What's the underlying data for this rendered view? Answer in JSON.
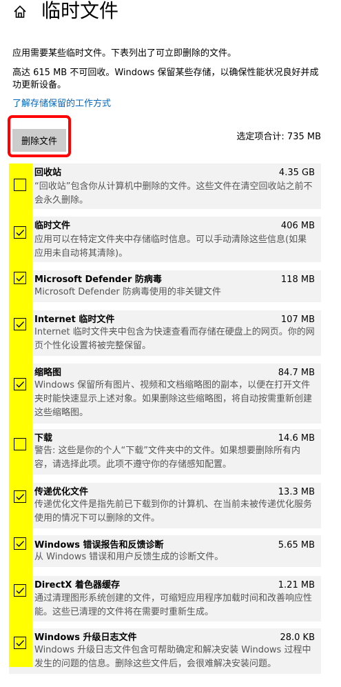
{
  "page": {
    "title": "临时文件"
  },
  "description": {
    "line1": "应用需要某些临时文件。下表列出了可立即删除的文件。",
    "line2": "高达 615 MB 不可回收。Windows 保留某些存储，以确保性能状况良好并成功更新设备。"
  },
  "link": {
    "learn_reserved": "了解存储保留的工作方式"
  },
  "actions": {
    "delete_label": "删除文件",
    "selected_total": "选定项合计: 735 MB"
  },
  "items": [
    {
      "title": "回收站",
      "size": "4.35 GB",
      "desc": "“回收站”包含你从计算机中删除的文件。这些文件在清空回收站之前不会永久删除。",
      "checked": false
    },
    {
      "title": "临时文件",
      "size": "406 MB",
      "desc": "应用可以在特定文件夹中存储临时信息。可以手动清除这些信息(如果应用未自动将其清除)。",
      "checked": true
    },
    {
      "title": "Microsoft Defender 防病毒",
      "size": "118 MB",
      "desc": "Microsoft Defender 防病毒使用的非关键文件",
      "checked": true
    },
    {
      "title": "Internet 临时文件",
      "size": "107 MB",
      "desc": "Internet 临时文件夹中包含为快速查看而存储在硬盘上的网页。你的网页个性化设置将被完整保留。",
      "checked": true
    },
    {
      "title": "缩略图",
      "size": "84.7 MB",
      "desc": "Windows 保留所有图片、视频和文档缩略图的副本，以便在打开文件夹时能快速显示上述对象。如果删除这些缩略图，将自动按需重新创建这些缩略图。",
      "checked": true
    },
    {
      "title": "下载",
      "size": "14.6 MB",
      "desc": "警告: 这些是你的个人“下载”文件夹中的文件。如果想要删除所有内容，请选择此项。此项不遵守你的存储感知配置。",
      "checked": false
    },
    {
      "title": "传递优化文件",
      "size": "13.3 MB",
      "desc": "传递优化文件是指先前已下载到你的计算机、在当前未被传递优化服务使用的情况下可以删除的文件。",
      "checked": true
    },
    {
      "title": "Windows 错误报告和反馈诊断",
      "size": "5.65 MB",
      "desc": "从 Windows 错误和用户反馈生成的诊断文件。",
      "checked": true
    },
    {
      "title": "DirectX 着色器缓存",
      "size": "1.21 MB",
      "desc": "通过清理图形系统创建的文件，可缩短应用程序加载时间和改善响应性能。这些已清理的文件将在需要时重新生成。",
      "checked": true
    },
    {
      "title": "Windows 升级日志文件",
      "size": "28.0 KB",
      "desc": "Windows 升级日志文件包含可帮助确定和解决安装 Windows 过程中发生的问题的信息。删除这些文件后，会很难解决安装问题。",
      "checked": true
    }
  ]
}
